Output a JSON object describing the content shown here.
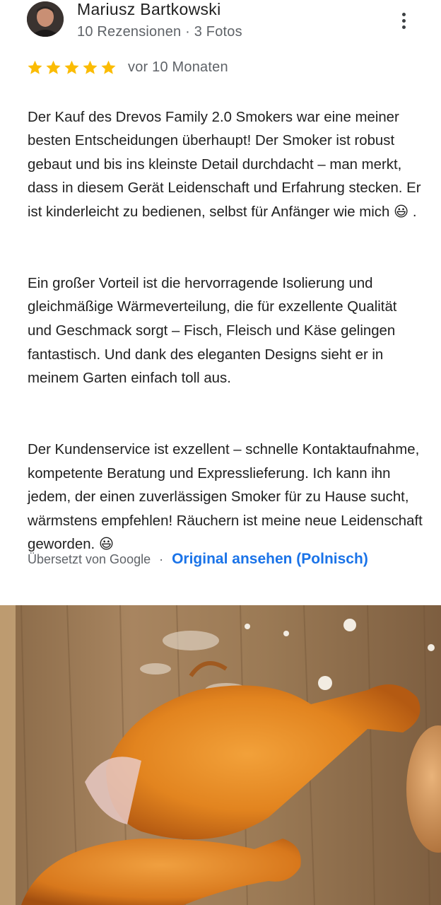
{
  "author": {
    "name": "Mariusz Bartkowski",
    "meta": "10 Rezensionen · 3 Fotos"
  },
  "rating": {
    "stars": 5,
    "max": 5,
    "date": "vor 10 Monaten"
  },
  "review": {
    "paragraphs": [
      "Der Kauf des Drevos Family 2.0 Smokers war eine meiner besten Entscheidungen überhaupt! Der Smoker ist robust gebaut und bis ins kleinste Detail durchdacht – man merkt, dass in diesem Gerät Leidenschaft und Erfahrung stecken. Er ist kinderleicht zu bedienen, selbst für Anfänger wie mich 😃 .",
      "Ein großer Vorteil ist die hervorragende Isolierung und gleichmäßige Wärmeverteilung, die für exzellente Qualität und Geschmack sorgt – Fisch, Fleisch und Käse gelingen fantastisch. Und dank des eleganten Designs sieht er in meinem Garten einfach toll aus.",
      "Der Kundenservice ist exzellent – schnelle Kontaktaufnahme, kompetente Beratung und Expresslieferung. Ich kann ihn jedem, der einen zuverlässigen Smoker für zu Hause sucht, wärmstens empfehlen! Räuchern ist meine neue Leidenschaft geworden. 😃"
    ]
  },
  "translation": {
    "translated_by": "Übersetzt von Google",
    "separator": "·",
    "original_link": "Original ansehen (Polnisch)"
  },
  "colors": {
    "star": "#fbbc04",
    "link": "#1a73e8",
    "meta_text": "#5f6368"
  },
  "icons": {
    "more": "more-vert-icon",
    "star": "star-icon"
  }
}
